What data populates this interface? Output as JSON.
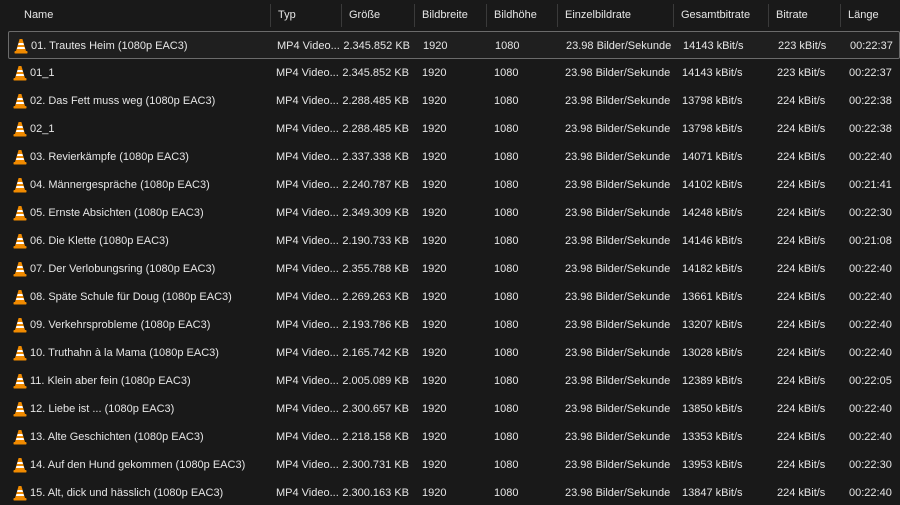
{
  "columns": [
    {
      "key": "name",
      "label": "Name"
    },
    {
      "key": "typ",
      "label": "Typ"
    },
    {
      "key": "groesse",
      "label": "Größe"
    },
    {
      "key": "bildbreite",
      "label": "Bildbreite"
    },
    {
      "key": "bildhoehe",
      "label": "Bildhöhe"
    },
    {
      "key": "einzelbildrate",
      "label": "Einzelbildrate"
    },
    {
      "key": "gesamtbitrate",
      "label": "Gesamtbitrate"
    },
    {
      "key": "bitrate",
      "label": "Bitrate"
    },
    {
      "key": "laenge",
      "label": "Länge"
    }
  ],
  "files": [
    {
      "name": "01. Trautes Heim (1080p EAC3)",
      "typ": "MP4 Video...",
      "groesse": "2.345.852 KB",
      "bildbreite": "1920",
      "bildhoehe": "1080",
      "einzelbildrate": "23.98 Bilder/Sekunde",
      "gesamtbitrate": "14143 kBit/s",
      "bitrate": "223 kBit/s",
      "laenge": "00:22:37",
      "selected": true
    },
    {
      "name": "01_1",
      "typ": "MP4 Video...",
      "groesse": "2.345.852 KB",
      "bildbreite": "1920",
      "bildhoehe": "1080",
      "einzelbildrate": "23.98 Bilder/Sekunde",
      "gesamtbitrate": "14143 kBit/s",
      "bitrate": "223 kBit/s",
      "laenge": "00:22:37"
    },
    {
      "name": "02. Das Fett muss weg (1080p EAC3)",
      "typ": "MP4 Video...",
      "groesse": "2.288.485 KB",
      "bildbreite": "1920",
      "bildhoehe": "1080",
      "einzelbildrate": "23.98 Bilder/Sekunde",
      "gesamtbitrate": "13798 kBit/s",
      "bitrate": "224 kBit/s",
      "laenge": "00:22:38"
    },
    {
      "name": "02_1",
      "typ": "MP4 Video...",
      "groesse": "2.288.485 KB",
      "bildbreite": "1920",
      "bildhoehe": "1080",
      "einzelbildrate": "23.98 Bilder/Sekunde",
      "gesamtbitrate": "13798 kBit/s",
      "bitrate": "224 kBit/s",
      "laenge": "00:22:38"
    },
    {
      "name": "03. Revierkämpfe (1080p EAC3)",
      "typ": "MP4 Video...",
      "groesse": "2.337.338 KB",
      "bildbreite": "1920",
      "bildhoehe": "1080",
      "einzelbildrate": "23.98 Bilder/Sekunde",
      "gesamtbitrate": "14071 kBit/s",
      "bitrate": "224 kBit/s",
      "laenge": "00:22:40"
    },
    {
      "name": "04. Männergespräche (1080p EAC3)",
      "typ": "MP4 Video...",
      "groesse": "2.240.787 KB",
      "bildbreite": "1920",
      "bildhoehe": "1080",
      "einzelbildrate": "23.98 Bilder/Sekunde",
      "gesamtbitrate": "14102 kBit/s",
      "bitrate": "224 kBit/s",
      "laenge": "00:21:41"
    },
    {
      "name": "05. Ernste Absichten (1080p EAC3)",
      "typ": "MP4 Video...",
      "groesse": "2.349.309 KB",
      "bildbreite": "1920",
      "bildhoehe": "1080",
      "einzelbildrate": "23.98 Bilder/Sekunde",
      "gesamtbitrate": "14248 kBit/s",
      "bitrate": "224 kBit/s",
      "laenge": "00:22:30"
    },
    {
      "name": "06. Die Klette (1080p EAC3)",
      "typ": "MP4 Video...",
      "groesse": "2.190.733 KB",
      "bildbreite": "1920",
      "bildhoehe": "1080",
      "einzelbildrate": "23.98 Bilder/Sekunde",
      "gesamtbitrate": "14146 kBit/s",
      "bitrate": "224 kBit/s",
      "laenge": "00:21:08"
    },
    {
      "name": "07. Der Verlobungsring (1080p EAC3)",
      "typ": "MP4 Video...",
      "groesse": "2.355.788 KB",
      "bildbreite": "1920",
      "bildhoehe": "1080",
      "einzelbildrate": "23.98 Bilder/Sekunde",
      "gesamtbitrate": "14182 kBit/s",
      "bitrate": "224 kBit/s",
      "laenge": "00:22:40"
    },
    {
      "name": "08. Späte Schule für Doug (1080p EAC3)",
      "typ": "MP4 Video...",
      "groesse": "2.269.263 KB",
      "bildbreite": "1920",
      "bildhoehe": "1080",
      "einzelbildrate": "23.98 Bilder/Sekunde",
      "gesamtbitrate": "13661 kBit/s",
      "bitrate": "224 kBit/s",
      "laenge": "00:22:40"
    },
    {
      "name": "09. Verkehrsprobleme (1080p EAC3)",
      "typ": "MP4 Video...",
      "groesse": "2.193.786 KB",
      "bildbreite": "1920",
      "bildhoehe": "1080",
      "einzelbildrate": "23.98 Bilder/Sekunde",
      "gesamtbitrate": "13207 kBit/s",
      "bitrate": "224 kBit/s",
      "laenge": "00:22:40"
    },
    {
      "name": "10. Truthahn à la Mama (1080p EAC3)",
      "typ": "MP4 Video...",
      "groesse": "2.165.742 KB",
      "bildbreite": "1920",
      "bildhoehe": "1080",
      "einzelbildrate": "23.98 Bilder/Sekunde",
      "gesamtbitrate": "13028 kBit/s",
      "bitrate": "224 kBit/s",
      "laenge": "00:22:40"
    },
    {
      "name": "11. Klein aber fein (1080p EAC3)",
      "typ": "MP4 Video...",
      "groesse": "2.005.089 KB",
      "bildbreite": "1920",
      "bildhoehe": "1080",
      "einzelbildrate": "23.98 Bilder/Sekunde",
      "gesamtbitrate": "12389 kBit/s",
      "bitrate": "224 kBit/s",
      "laenge": "00:22:05"
    },
    {
      "name": "12. Liebe ist ... (1080p EAC3)",
      "typ": "MP4 Video...",
      "groesse": "2.300.657 KB",
      "bildbreite": "1920",
      "bildhoehe": "1080",
      "einzelbildrate": "23.98 Bilder/Sekunde",
      "gesamtbitrate": "13850 kBit/s",
      "bitrate": "224 kBit/s",
      "laenge": "00:22:40"
    },
    {
      "name": "13. Alte Geschichten (1080p EAC3)",
      "typ": "MP4 Video...",
      "groesse": "2.218.158 KB",
      "bildbreite": "1920",
      "bildhoehe": "1080",
      "einzelbildrate": "23.98 Bilder/Sekunde",
      "gesamtbitrate": "13353 kBit/s",
      "bitrate": "224 kBit/s",
      "laenge": "00:22:40"
    },
    {
      "name": "14. Auf den Hund gekommen (1080p EAC3)",
      "typ": "MP4 Video...",
      "groesse": "2.300.731 KB",
      "bildbreite": "1920",
      "bildhoehe": "1080",
      "einzelbildrate": "23.98 Bilder/Sekunde",
      "gesamtbitrate": "13953 kBit/s",
      "bitrate": "224 kBit/s",
      "laenge": "00:22:30"
    },
    {
      "name": "15. Alt, dick und hässlich (1080p EAC3)",
      "typ": "MP4 Video...",
      "groesse": "2.300.163 KB",
      "bildbreite": "1920",
      "bildhoehe": "1080",
      "einzelbildrate": "23.98 Bilder/Sekunde",
      "gesamtbitrate": "13847 kBit/s",
      "bitrate": "224 kBit/s",
      "laenge": "00:22:40"
    }
  ],
  "icon": "vlc-cone-icon",
  "colors": {
    "background": "#191919",
    "text": "#e6e6e6",
    "selection_border": "#6b6b6b",
    "icon_orange": "#f08a00"
  }
}
